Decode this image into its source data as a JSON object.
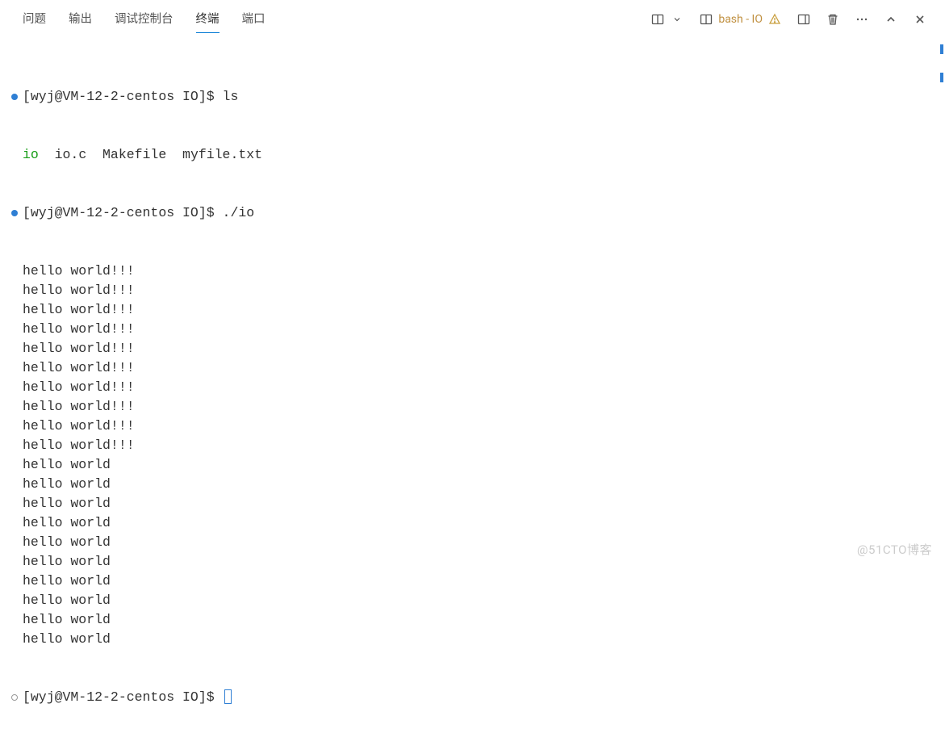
{
  "tabs": {
    "problems": "问题",
    "output": "输出",
    "debug_console": "调试控制台",
    "terminal": "终端",
    "ports": "端口"
  },
  "toolbar": {
    "shell_label": "bash - IO"
  },
  "terminal": {
    "prompt1": "[wyj@VM-12-2-centos IO]$ ",
    "cmd1": "ls",
    "ls_out_green": "io",
    "ls_out_rest": "  io.c  Makefile  myfile.txt",
    "prompt2": "[wyj@VM-12-2-centos IO]$ ",
    "cmd2": "./io",
    "hello_excl": "hello world!!!",
    "hello_plain": "hello world",
    "excl_count": 10,
    "plain_count": 10,
    "prompt3": "[wyj@VM-12-2-centos IO]$ "
  },
  "watermark": "@51CTO博客"
}
